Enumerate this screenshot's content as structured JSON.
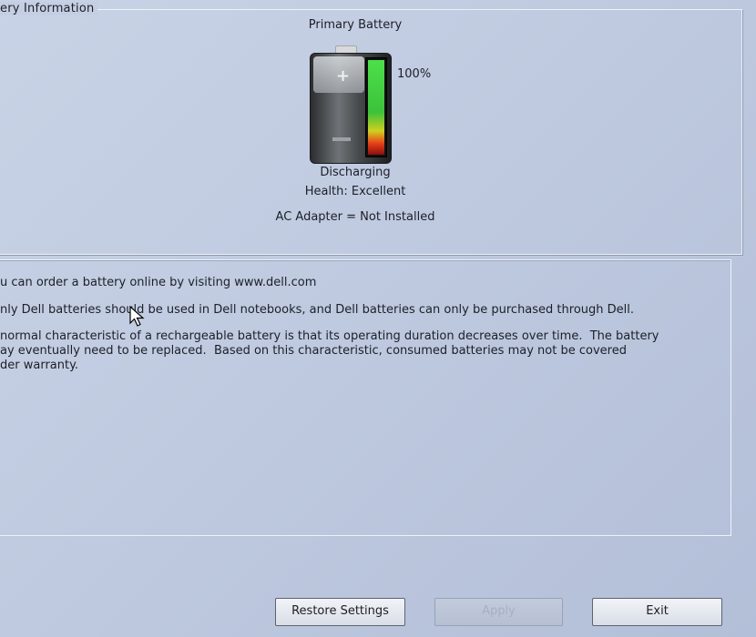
{
  "group": {
    "legend": "ery Information"
  },
  "battery": {
    "title": "Primary Battery",
    "percent_text": "100%",
    "charge_fraction": 1.0,
    "state": "Discharging",
    "health": "Health: Excellent",
    "ac_adapter": "AC Adapter = Not Installed"
  },
  "info": {
    "line1": "u can order a battery online by visiting www.dell.com",
    "line2": "nly Dell batteries should be used in Dell notebooks, and Dell batteries can only be purchased through Dell.",
    "line3": "normal characteristic of a rechargeable battery is that its operating duration decreases over time.  The battery",
    "line4": "ay eventually need to be replaced.  Based on this characteristic, consumed batteries may not be covered",
    "line5": "der warranty."
  },
  "buttons": {
    "restore": "Restore Settings",
    "apply": "Apply",
    "exit": "Exit"
  },
  "icons": {
    "battery": "battery-icon",
    "cursor": "mouse-pointer-icon"
  }
}
